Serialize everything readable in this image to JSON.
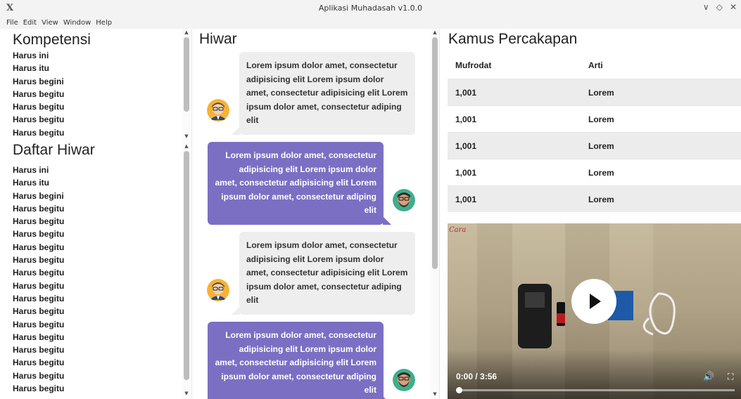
{
  "window": {
    "title": "Aplikasi Muhadasah v1.0.0",
    "app_icon": "X",
    "controls": [
      "∨",
      "◇",
      "✕"
    ]
  },
  "menu": [
    "File",
    "Edit",
    "View",
    "Window",
    "Help"
  ],
  "kompetensi": {
    "title": "Kompetensi",
    "items": [
      "Harus ini",
      "Harus itu",
      "Harus begini",
      "Harus begitu",
      "Harus begitu",
      "Harus begitu",
      "Harus begitu"
    ]
  },
  "daftar_hiwar": {
    "title": "Daftar Hiwar",
    "items": [
      "Harus ini",
      "Harus itu",
      "Harus begini",
      "Harus begitu",
      "Harus begitu",
      "Harus begitu",
      "Harus begitu",
      "Harus begitu",
      "Harus begitu",
      "Harus begitu",
      "Harus begitu",
      "Harus begitu",
      "Harus begitu",
      "Harus begitu",
      "Harus begitu",
      "Harus begitu",
      "Harus begitu",
      "Harus begitu"
    ]
  },
  "hiwar": {
    "title": "Hiwar",
    "messages": [
      {
        "side": "recv",
        "text": "Lorem ipsum dolor amet, consectetur adipisicing elit Lorem ipsum dolor amet, consectetur adipisicing elit Lorem ipsum dolor amet, consectetur adiping elit",
        "avatar": "avatar-man-glasses-icon"
      },
      {
        "side": "sent",
        "text": "Lorem ipsum dolor amet, consectetur adipisicing elit Lorem ipsum dolor amet, consectetur adipisicing elit Lorem ipsum dolor amet, consectetur adiping elit",
        "avatar": "avatar-man-beard-icon"
      },
      {
        "side": "recv",
        "text": "Lorem ipsum dolor amet, consectetur adipisicing elit Lorem ipsum dolor amet, consectetur adipisicing elit Lorem ipsum dolor amet, consectetur adiping elit",
        "avatar": "avatar-man-glasses-icon"
      },
      {
        "side": "sent",
        "text": "Lorem ipsum dolor amet, consectetur adipisicing elit Lorem ipsum dolor amet, consectetur adipisicing elit Lorem ipsum dolor amet, consectetur adiping elit",
        "avatar": "avatar-man-beard-icon"
      }
    ]
  },
  "kamus": {
    "title": "Kamus Percakapan",
    "columns": [
      "Mufrodat",
      "Arti"
    ],
    "rows": [
      [
        "1,001",
        "Lorem"
      ],
      [
        "1,001",
        "Lorem"
      ],
      [
        "1,001",
        "Lorem"
      ],
      [
        "1,001",
        "Lorem"
      ],
      [
        "1,001",
        "Lorem"
      ]
    ]
  },
  "video": {
    "time": "0:00 / 3:56",
    "progress": 0.0,
    "logo_text": "Cara"
  },
  "colors": {
    "sent_bubble": "#7b6fc4",
    "recv_bubble": "#eeeeee",
    "row_alt": "#ececec"
  }
}
